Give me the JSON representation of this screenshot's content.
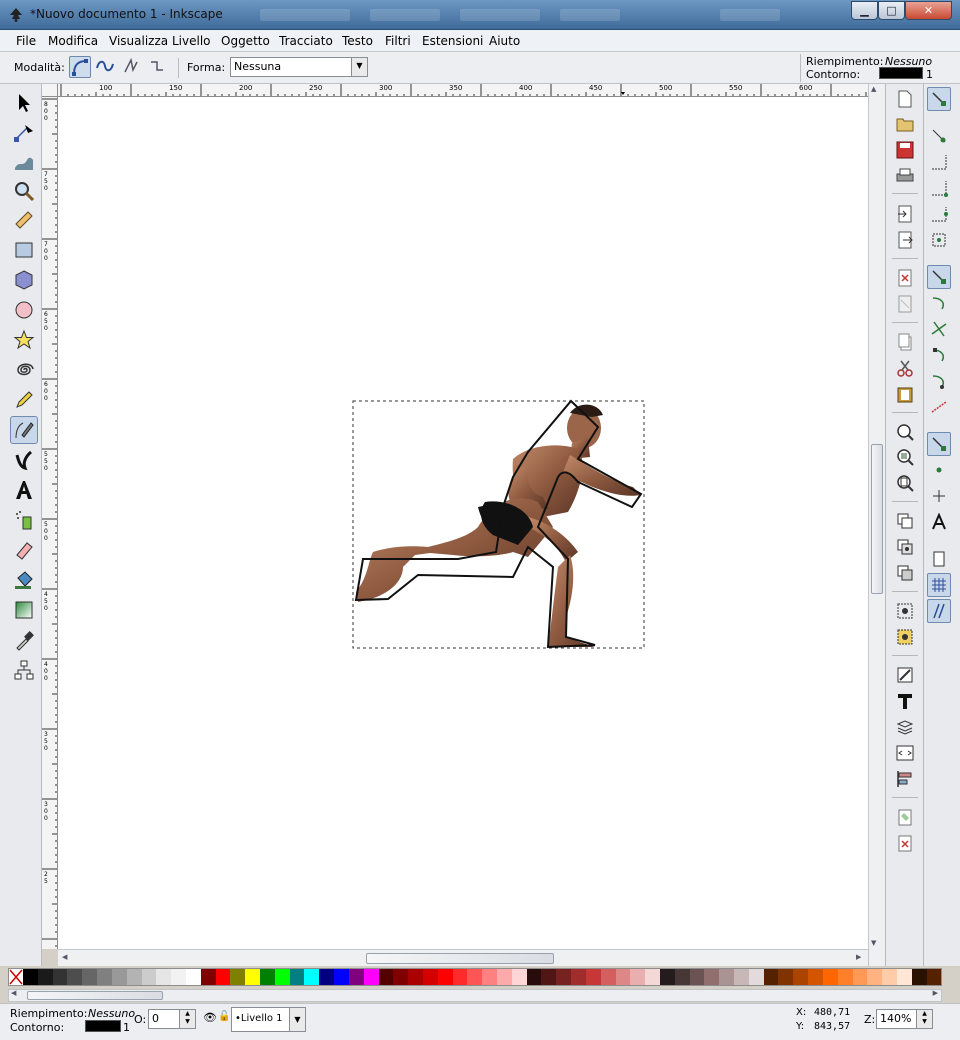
{
  "window": {
    "title": "*Nuovo documento 1 - Inkscape",
    "buttons": {
      "minimize": "▁",
      "maximize": "□",
      "close": "✕"
    }
  },
  "menu": [
    "File",
    "Modifica",
    "Visualizza",
    "Livello",
    "Oggetto",
    "Tracciato",
    "Testo",
    "Filtri",
    "Estensioni",
    "Aiuto"
  ],
  "tool_controls": {
    "mode_label": "Modalità:",
    "shape_label": "Forma:",
    "shape_value": "Nessuna",
    "fill_label": "Riempimento:",
    "fill_value": "Nessuno",
    "stroke_label": "Contorno:",
    "stroke_width": "1"
  },
  "rulers": {
    "top": [
      "100",
      "150",
      "200",
      "250",
      "300",
      "350",
      "400",
      "450",
      "500",
      "550",
      "600"
    ],
    "left": [
      "8\n0\n0",
      "7\n5\n0",
      "7\n0\n0",
      "6\n5\n0",
      "6\n0\n0",
      "5\n5\n0",
      "5\n0\n0",
      "4\n5\n0",
      "4\n0\n0",
      "3\n5\n0",
      "3\n0\n0",
      "2\n5"
    ]
  },
  "tools": [
    "selector-tool",
    "node-tool",
    "tweak-tool",
    "zoom-tool",
    "measure-tool",
    "rectangle-tool",
    "box3d-tool",
    "ellipse-tool",
    "star-tool",
    "spiral-tool",
    "pencil-tool",
    "pen-tool",
    "calligraphy-tool",
    "text-tool",
    "spray-tool",
    "eraser-tool",
    "paint-bucket-tool",
    "gradient-tool",
    "dropper-tool",
    "connector-tool"
  ],
  "status": {
    "fill_label": "Riempimento:",
    "fill_value": "Nessuno",
    "stroke_label": "Contorno:",
    "stroke_width": "1",
    "opacity_label": "O:",
    "opacity_value": "0",
    "layer": "•Livello 1",
    "x_label": "X:",
    "x_value": "480,71",
    "y_label": "Y:",
    "y_value": "843,57",
    "zoom_label": "Z:",
    "zoom_value": "140%"
  },
  "palette": [
    "#000000",
    "#1a1a1a",
    "#333333",
    "#4d4d4d",
    "#666666",
    "#808080",
    "#999999",
    "#b3b3b3",
    "#cccccc",
    "#e6e6e6",
    "#f2f2f2",
    "#ffffff",
    "#800000",
    "#ff0000",
    "#808000",
    "#ffff00",
    "#008000",
    "#00ff00",
    "#008080",
    "#00ffff",
    "#000080",
    "#0000ff",
    "#800080",
    "#ff00ff",
    "#550000",
    "#800000",
    "#aa0000",
    "#d40000",
    "#ff0000",
    "#ff2a2a",
    "#ff5555",
    "#ff8080",
    "#ffaaaa",
    "#ffd5d5",
    "#280b0b",
    "#501616",
    "#782121",
    "#a02c2c",
    "#c83737",
    "#d35f5f",
    "#de8787",
    "#e9afaf",
    "#f4d7d7",
    "#241c1c",
    "#483737",
    "#6c5353",
    "#916f6f",
    "#ac9393",
    "#c8b7b7",
    "#e3dbdb",
    "#552200",
    "#803300",
    "#aa4400",
    "#d45500",
    "#ff6600",
    "#ff7f2a",
    "#ff9955",
    "#ffb380",
    "#ffccaa",
    "#ffe6d5",
    "#2b1100",
    "#552200"
  ]
}
